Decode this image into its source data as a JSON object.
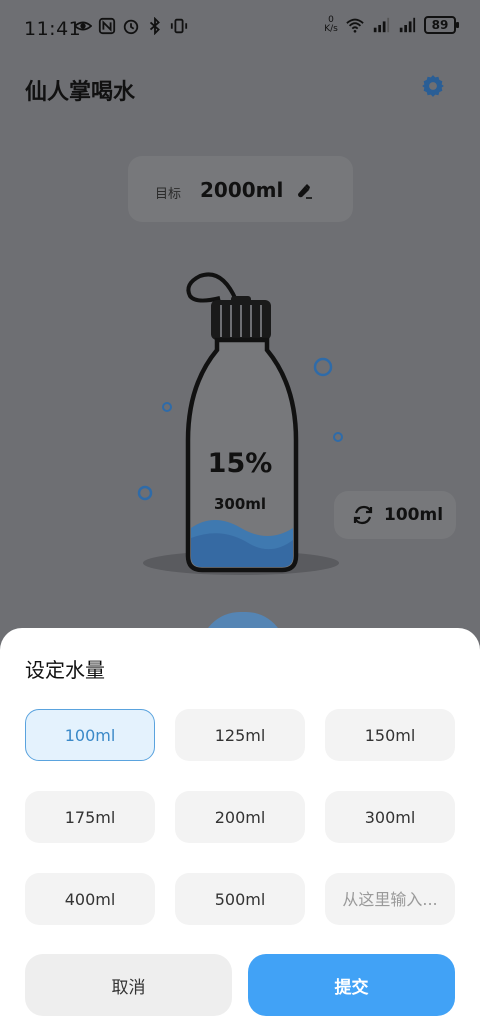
{
  "status_bar": {
    "time": "11:41",
    "network_speed_top": "0",
    "network_speed_unit": "K/s",
    "battery": "89"
  },
  "app": {
    "title": "仙人掌喝水",
    "icons": {
      "settings": "gear-icon",
      "edit": "edit-pen-icon",
      "swap": "refresh-icon"
    }
  },
  "goal": {
    "label": "目标",
    "value": "2000ml"
  },
  "bottle": {
    "percent_text": "15%",
    "amount_text": "300ml",
    "fill_fraction": 0.15
  },
  "cup": {
    "value": "100ml"
  },
  "sheet": {
    "title": "设定水量",
    "options": [
      "100ml",
      "125ml",
      "150ml",
      "175ml",
      "200ml",
      "300ml",
      "400ml",
      "500ml"
    ],
    "selected": "100ml",
    "custom_placeholder": "从这里输入...",
    "cancel_label": "取消",
    "submit_label": "提交"
  },
  "colors": {
    "accent": "#41a2f6",
    "selected_bg": "#e4f2fd",
    "selected_text": "#3a89c8",
    "overlay_bg": "#6e6f73"
  }
}
